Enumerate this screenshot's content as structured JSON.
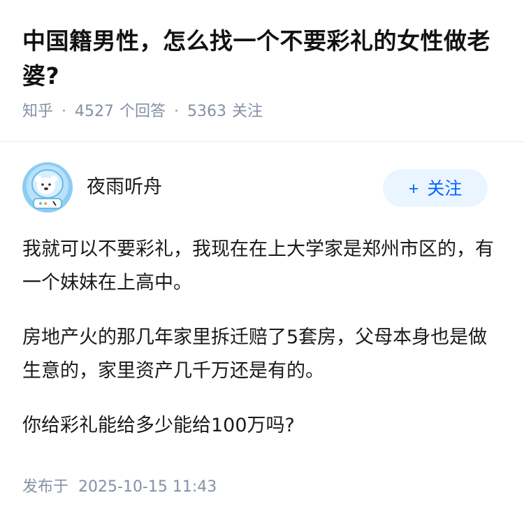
{
  "question": {
    "title": "中国籍男性，怎么找一个不要彩礼的女性做老婆?",
    "source": "知乎",
    "answer_count": "4527",
    "answer_label": "个回答",
    "follow_count": "5363",
    "follow_label": "关注"
  },
  "author": {
    "name": "夜雨听舟",
    "avatar_icon": "polar-bear-astronaut-avatar",
    "follow_button_label": "关注",
    "follow_button_icon": "+"
  },
  "answer": {
    "paragraphs": [
      "我就可以不要彩礼，我现在在上大学家是郑州市区的，有一个妹妹在上高中。",
      "房地产火的那几年家里拆迁赔了5套房，父母本身也是做生意的，家里资产几千万还是有的。",
      "你给彩礼能给多少能给100万吗?"
    ],
    "publish_label": "发布于",
    "publish_time": "2025-10-15 11:43"
  },
  "colors": {
    "meta_gray": "#8590a6",
    "brand_blue": "#0066ff",
    "follow_bg": "#ebf5ff",
    "divider": "#ebebeb"
  }
}
